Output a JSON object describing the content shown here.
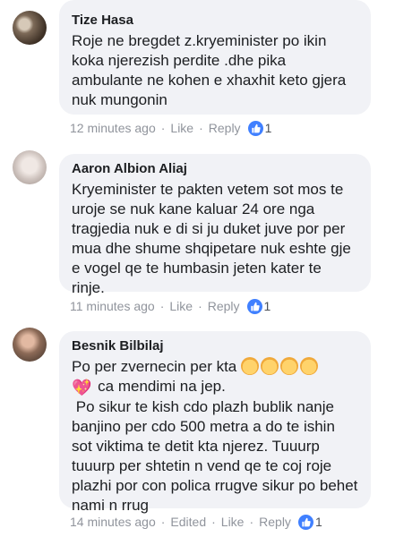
{
  "comments": [
    {
      "author": "Tize Hasa",
      "text": "Roje ne bregdet z.kryeminister po ikin koka njerezish perdite .dhe pika ambulante ne kohen e xhaxhit keto gjera nuk mungonin",
      "time": "12 minutes ago",
      "like_label": "Like",
      "reply_label": "Reply",
      "likes": "1",
      "avatar_icon": "profile-photo"
    },
    {
      "author": "Aaron Albion Aliaj",
      "text": "Kryeminister te pakten vetem sot mos te uroje se nuk kane kaluar 24 ore nga tragjedia nuk e di si ju duket juve por per mua dhe shume shqipetare nuk eshte gje e vogel qe te humbasin jeten kater te rinje.",
      "time": "11 minutes ago",
      "like_label": "Like",
      "reply_label": "Reply",
      "likes": "1",
      "avatar_icon": "profile-photo"
    },
    {
      "author": "Besnik Bilbilaj",
      "text_line1": "Po per zvernecin per kta",
      "text_line2": " ca mendimi na jep.",
      "text_rest": " Po sikur te kish cdo plazh bublik nanje banjino per cdo 500 metra a do te ishin sot viktima te detit kta njerez. Tuuurp tuuurp per shtetin n vend qe te coj roje plazhi por con polica rrugve sikur po behet nami n rrug",
      "emojis": [
        "person-blond-emoji",
        "person-blond-emoji",
        "older-person-emoji",
        "baby-emoji"
      ],
      "heart_icon": "sparkling-heart-emoji",
      "time": "14 minutes ago",
      "edited_label": "Edited",
      "like_label": "Like",
      "reply_label": "Reply",
      "likes": "1",
      "avatar_icon": "profile-photo"
    }
  ],
  "colors": {
    "bubble": "#f1f2f6",
    "meta_text": "#90949c",
    "like_badge": "#4080ff"
  }
}
